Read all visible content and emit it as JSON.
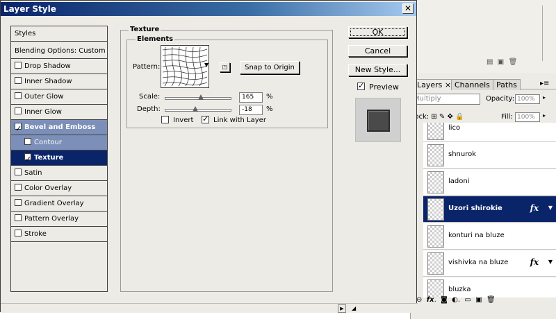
{
  "dialog": {
    "title": "Layer Style",
    "close_glyph": "✕",
    "buttons": {
      "ok": "OK",
      "cancel": "Cancel",
      "new_style": "New Style..."
    },
    "preview_label": "Preview",
    "preview_checked": true
  },
  "styles_list": {
    "header": "Styles",
    "blending": "Blending Options: Custom",
    "items": [
      {
        "label": "Drop Shadow",
        "checked": false
      },
      {
        "label": "Inner Shadow",
        "checked": false
      },
      {
        "label": "Outer Glow",
        "checked": false
      },
      {
        "label": "Inner Glow",
        "checked": false
      },
      {
        "label": "Bevel and Emboss",
        "checked": true
      },
      {
        "label": "Contour",
        "checked": false
      },
      {
        "label": "Texture",
        "checked": true
      },
      {
        "label": "Satin",
        "checked": false
      },
      {
        "label": "Color Overlay",
        "checked": false
      },
      {
        "label": "Gradient Overlay",
        "checked": false
      },
      {
        "label": "Pattern Overlay",
        "checked": false
      },
      {
        "label": "Stroke",
        "checked": false
      }
    ]
  },
  "texture": {
    "group_title": "Texture",
    "elements_title": "Elements",
    "pattern_label": "Pattern:",
    "snap_button": "Snap to Origin",
    "scale_label": "Scale:",
    "scale_value": "165",
    "scale_unit": "%",
    "depth_label": "Depth:",
    "depth_value": "-18",
    "depth_unit": "%",
    "invert_label": "Invert",
    "invert_checked": false,
    "link_label": "Link with Layer",
    "link_checked": true
  },
  "layers_panel": {
    "tabs": [
      "Layers",
      "Channels",
      "Paths"
    ],
    "blend_mode": "Multiply",
    "opacity_label": "Opacity:",
    "opacity_value": "100%",
    "lock_label": "Lock:",
    "fill_label": "Fill:",
    "fill_value": "100%",
    "layers": [
      {
        "name": "lico",
        "fx": false,
        "selected": false
      },
      {
        "name": "shnurok",
        "fx": false,
        "selected": false
      },
      {
        "name": "ladoni",
        "fx": false,
        "selected": false
      },
      {
        "name": "Uzori shirokie",
        "fx": true,
        "selected": true
      },
      {
        "name": "konturi na bluze",
        "fx": false,
        "selected": false
      },
      {
        "name": "vishivka na bluze",
        "fx": true,
        "selected": false
      },
      {
        "name": "bluzka",
        "fx": false,
        "selected": false
      }
    ],
    "fx_glyph": "fx"
  }
}
